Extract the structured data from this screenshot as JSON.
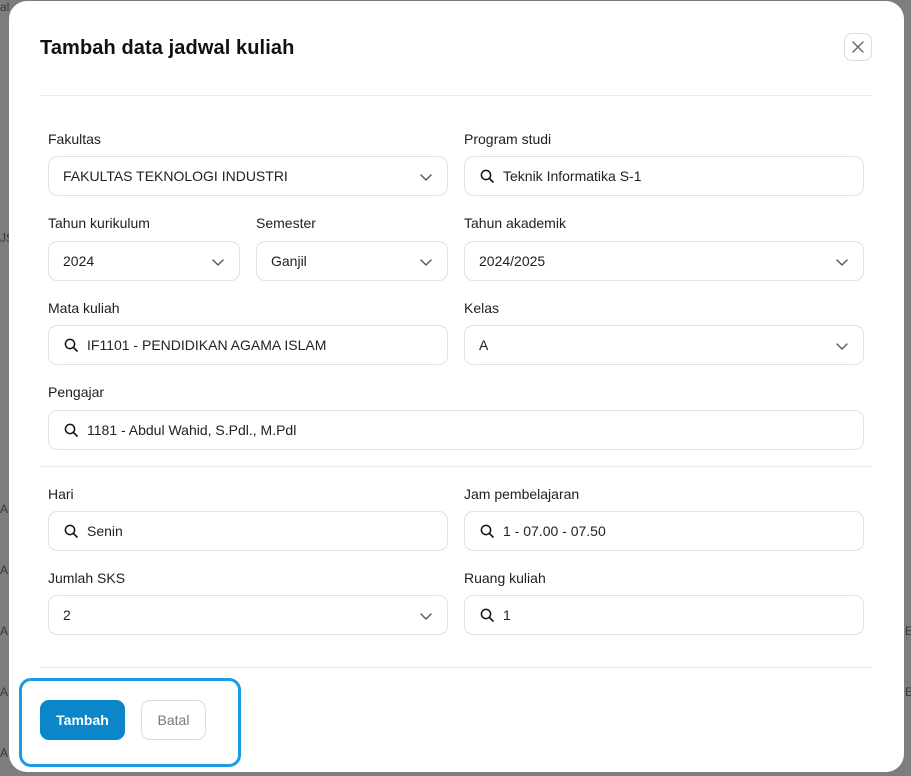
{
  "backdrop": {
    "fragments": [
      "al",
      "JS",
      "AN",
      "AN",
      "A",
      "A",
      "A",
      "A",
      "E",
      "E"
    ]
  },
  "modal": {
    "title": "Tambah data jadwal kuliah"
  },
  "form": {
    "fakultas": {
      "label": "Fakultas",
      "value": "FAKULTAS TEKNOLOGI INDUSTRI"
    },
    "program_studi": {
      "label": "Program studi",
      "value": "Teknik Informatika S-1"
    },
    "tahun_kurikulum": {
      "label": "Tahun kurikulum",
      "value": "2024"
    },
    "semester": {
      "label": "Semester",
      "value": "Ganjil"
    },
    "tahun_akademik": {
      "label": "Tahun akademik",
      "value": "2024/2025"
    },
    "mata_kuliah": {
      "label": "Mata kuliah",
      "value": "IF1101 - PENDIDIKAN AGAMA ISLAM"
    },
    "kelas": {
      "label": "Kelas",
      "value": "A"
    },
    "pengajar": {
      "label": "Pengajar",
      "value": "1181 - Abdul Wahid, S.Pdl., M.Pdl"
    },
    "hari": {
      "label": "Hari",
      "value": "Senin"
    },
    "jam_pembelajaran": {
      "label": "Jam pembelajaran",
      "value": "1 - 07.00 - 07.50"
    },
    "jumlah_sks": {
      "label": "Jumlah SKS",
      "value": "2"
    },
    "ruang_kuliah": {
      "label": "Ruang kuliah",
      "value": "1"
    }
  },
  "actions": {
    "submit_label": "Tambah",
    "cancel_label": "Batal"
  },
  "colors": {
    "primary": "#0b87c9",
    "focus_ring": "#1a9be6",
    "backdrop": "#7d7d7d"
  },
  "icons": {
    "close": "close-icon",
    "search": "search-icon",
    "dropdown": "chevron-down-icon"
  }
}
